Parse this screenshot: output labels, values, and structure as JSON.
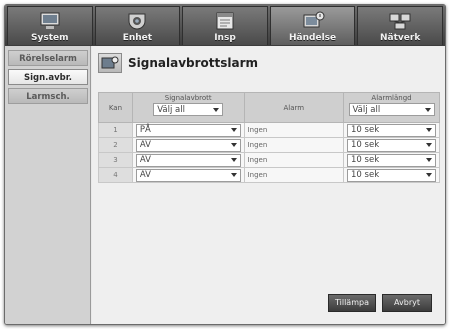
{
  "topnav": {
    "tabs": [
      {
        "label": "System",
        "icon": "monitor-icon"
      },
      {
        "label": "Enhet",
        "icon": "camera-icon"
      },
      {
        "label": "Insp",
        "icon": "calendar-icon"
      },
      {
        "label": "Händelse",
        "icon": "event-icon"
      },
      {
        "label": "Nätverk",
        "icon": "network-icon"
      }
    ],
    "active_index": 3
  },
  "sidebar": {
    "items": [
      {
        "label": "Rörelselarm"
      },
      {
        "label": "Sign.avbr."
      },
      {
        "label": "Larmsch."
      }
    ],
    "active_index": 1
  },
  "page": {
    "title": "Signalavbrottslarm",
    "icon": "camera-signal-icon"
  },
  "table": {
    "headers": {
      "kan": "Kan",
      "signal": "Signalavbrott",
      "alarm": "Alarm",
      "duration": "Alarmlängd"
    },
    "select_all": {
      "signal": "Välj all",
      "duration": "Välj all"
    },
    "rows": [
      {
        "kan": "1",
        "signal": "PÅ",
        "alarm": "Ingen",
        "duration": "10 sek"
      },
      {
        "kan": "2",
        "signal": "AV",
        "alarm": "Ingen",
        "duration": "10 sek"
      },
      {
        "kan": "3",
        "signal": "AV",
        "alarm": "Ingen",
        "duration": "10 sek"
      },
      {
        "kan": "4",
        "signal": "AV",
        "alarm": "Ingen",
        "duration": "10 sek"
      }
    ]
  },
  "buttons": {
    "apply": "Tillämpa",
    "cancel": "Avbryt"
  },
  "colors": {
    "topbar": "#4a4a4a",
    "sidebar": "#d2d2d2",
    "panel": "#efefef"
  }
}
